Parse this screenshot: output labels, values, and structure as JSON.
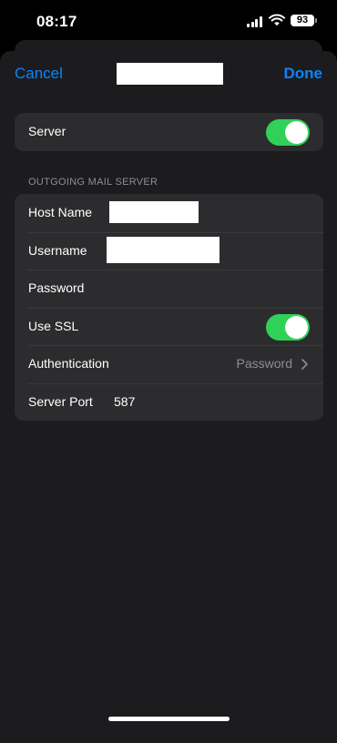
{
  "status_bar": {
    "time": "08:17",
    "battery": "93",
    "icons": [
      "signal-icon",
      "wifi-icon",
      "battery-icon"
    ]
  },
  "nav": {
    "cancel_label": "Cancel",
    "title": "",
    "done_label": "Done"
  },
  "server_row": {
    "label": "Server",
    "toggle_on": true
  },
  "outgoing_section": {
    "header": "OUTGOING MAIL SERVER",
    "host_name": {
      "label": "Host Name",
      "value": ""
    },
    "username": {
      "label": "Username",
      "value": ""
    },
    "password": {
      "label": "Password",
      "value": ""
    },
    "use_ssl": {
      "label": "Use SSL",
      "toggle_on": true
    },
    "authentication": {
      "label": "Authentication",
      "value": "Password"
    },
    "server_port": {
      "label": "Server Port",
      "value": "587"
    }
  },
  "colors": {
    "accent": "#0a84ff",
    "toggle_on": "#30d158",
    "background": "#000000",
    "sheet": "#1c1c1e",
    "cell": "#2c2c2e",
    "secondary_text": "#8e8e93"
  }
}
